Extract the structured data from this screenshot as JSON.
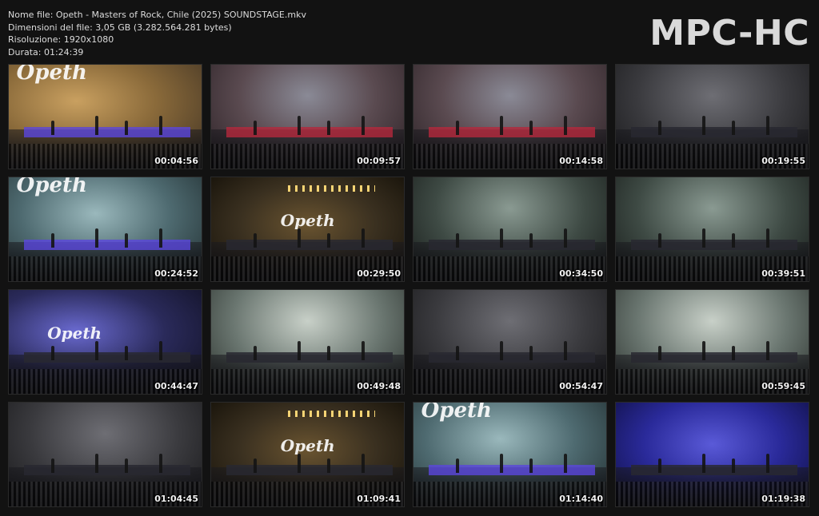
{
  "window": {
    "app_logo": "MPC-HC"
  },
  "info": {
    "file_name": "Nome file: Opeth - Masters of Rock, Chile (2025) SOUNDSTAGE.mkv",
    "file_size": "Dimensioni del file: 3,05 GB (3.282.564.281 bytes)",
    "resolution": "Risoluzione: 1920x1080",
    "duration": "Durata: 01:24:39"
  },
  "thumbnails": [
    {
      "time": "00:04:56",
      "scene": "logo-warm"
    },
    {
      "time": "00:09:57",
      "scene": "red-stage"
    },
    {
      "time": "00:14:58",
      "scene": "red-stage"
    },
    {
      "time": "00:19:55",
      "scene": "dark-stage"
    },
    {
      "time": "00:24:52",
      "scene": "teal-logo"
    },
    {
      "time": "00:29:50",
      "scene": "screen-logo"
    },
    {
      "time": "00:34:50",
      "scene": "green-stage"
    },
    {
      "time": "00:39:51",
      "scene": "green-stage"
    },
    {
      "time": "00:44:47",
      "scene": "blue-logo"
    },
    {
      "time": "00:49:48",
      "scene": "pale-stage"
    },
    {
      "time": "00:54:47",
      "scene": "dark-stage"
    },
    {
      "time": "00:59:45",
      "scene": "pale-stage"
    },
    {
      "time": "01:04:45",
      "scene": "dark-stage"
    },
    {
      "time": "01:09:41",
      "scene": "screen-logo"
    },
    {
      "time": "01:14:40",
      "scene": "teal-logo"
    },
    {
      "time": "01:19:38",
      "scene": "blue-stage"
    }
  ],
  "scene_colors": {
    "logo-warm": "#8a6a3a",
    "red-stage": "#5a4a50",
    "dark-stage": "#3a3a3e",
    "teal-logo": "#4e6a70",
    "screen-logo": "#3a3020",
    "green-stage": "#3e4a44",
    "blue-logo": "#2a2a5a",
    "pale-stage": "#6a7670",
    "blue-stage": "#2a2a9a"
  },
  "thumbnail_logo_text": "Opeth"
}
